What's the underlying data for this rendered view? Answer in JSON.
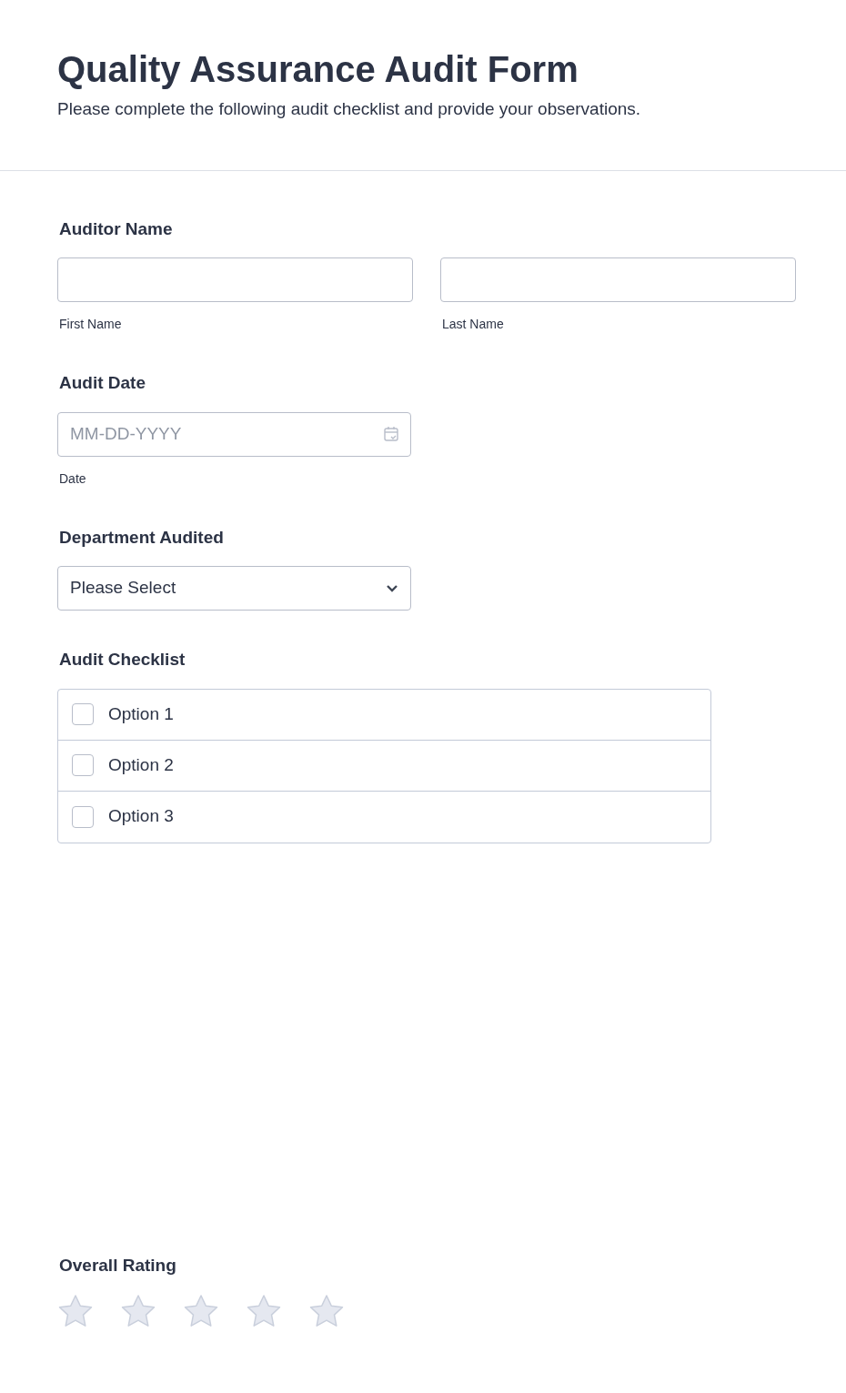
{
  "header": {
    "title": "Quality Assurance Audit Form",
    "subtitle": "Please complete the following audit checklist and provide your observations."
  },
  "auditor_name": {
    "label": "Auditor Name",
    "fields": [
      {
        "sublabel": "First Name"
      },
      {
        "sublabel": "Last Name"
      }
    ]
  },
  "audit_date": {
    "label": "Audit Date",
    "placeholder": "MM-DD-YYYY",
    "sublabel": "Date"
  },
  "department": {
    "label": "Department Audited",
    "value": "Please Select"
  },
  "checklist": {
    "label": "Audit Checklist",
    "options": [
      {
        "label": "Option 1",
        "checked": false
      },
      {
        "label": "Option 2",
        "checked": false
      },
      {
        "label": "Option 3",
        "checked": false
      }
    ]
  },
  "rating": {
    "label": "Overall Rating",
    "stars": 0
  }
}
